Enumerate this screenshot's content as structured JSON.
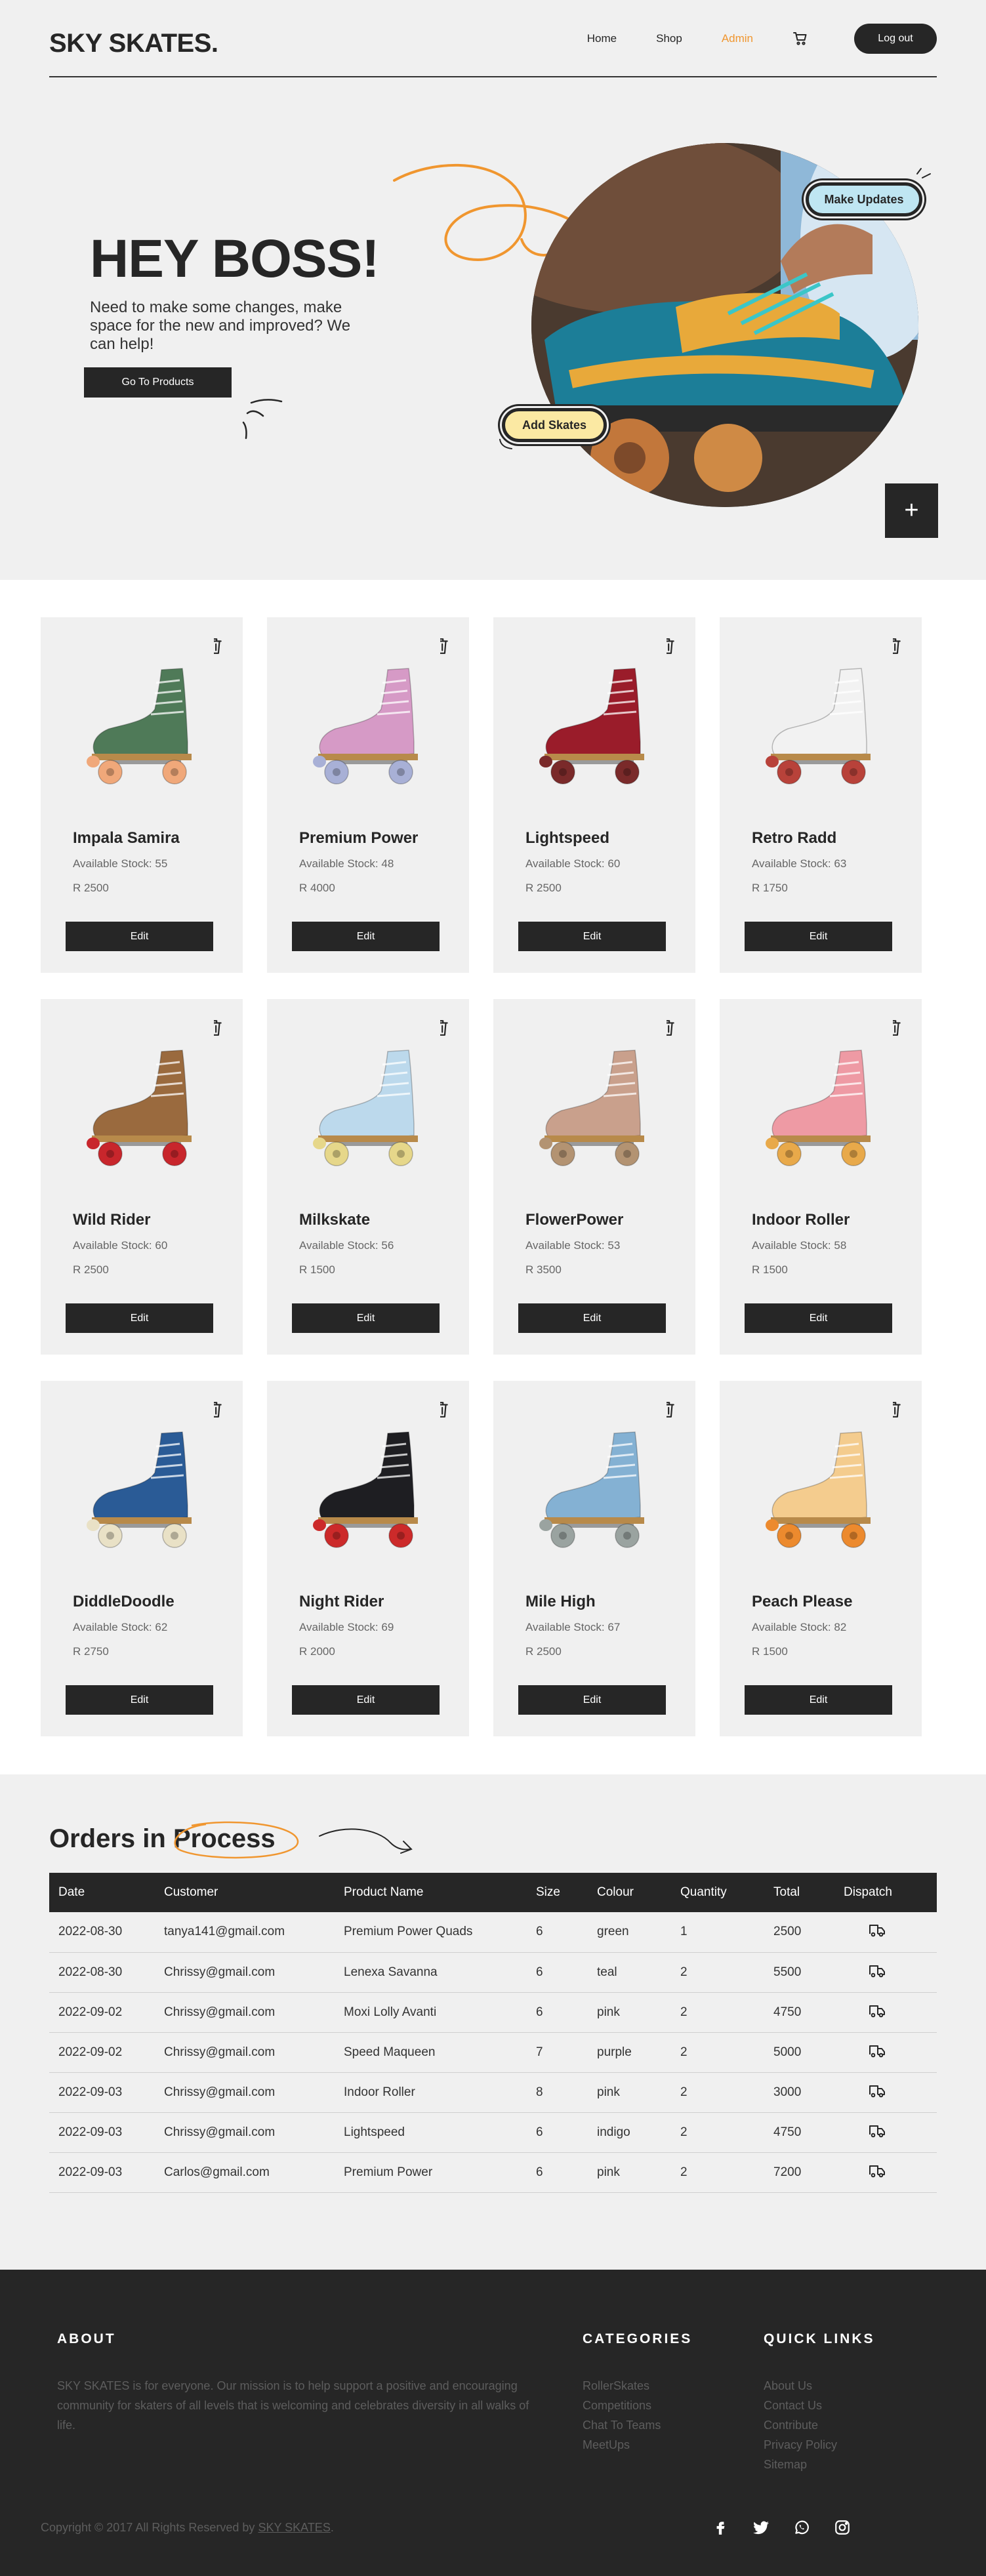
{
  "nav": {
    "brand": "SKY SKATES.",
    "links": [
      {
        "label": "Home"
      },
      {
        "label": "Shop"
      },
      {
        "label": "Admin"
      }
    ],
    "active_link": "Admin",
    "logout_label": "Log out",
    "cart_icon": "cart-icon"
  },
  "hero": {
    "title": "HEY BOSS!",
    "subtitle": "Need to make some changes, make space for the new and improved? We can help!",
    "cta_label": "Go To Products",
    "make_updates_label": "Make Updates",
    "add_skates_label": "Add Skates",
    "plus_label": "+"
  },
  "products": [
    {
      "name": "Impala Samira",
      "stock": "Available Stock: 55",
      "price": "R 2500",
      "boot": "#4f7a58",
      "wheel": "#f0a87a"
    },
    {
      "name": "Premium Power",
      "stock": "Available Stock: 48",
      "price": "R 4000",
      "boot": "#d69ac6",
      "wheel": "#a8b0d6"
    },
    {
      "name": "Lightspeed",
      "stock": "Available Stock: 60",
      "price": "R 2500",
      "boot": "#9a1c2a",
      "wheel": "#7a2a2a"
    },
    {
      "name": "Retro Radd",
      "stock": "Available Stock: 63",
      "price": "R 1750",
      "boot": "#f2f2f2",
      "wheel": "#b8423a"
    },
    {
      "name": "Wild Rider",
      "stock": "Available Stock: 60",
      "price": "R 2500",
      "boot": "#9a6a3e",
      "wheel": "#c8262c"
    },
    {
      "name": "Milkskate",
      "stock": "Available Stock: 56",
      "price": "R 1500",
      "boot": "#bcd9ec",
      "wheel": "#e6d78a"
    },
    {
      "name": "FlowerPower",
      "stock": "Available Stock: 53",
      "price": "R 3500",
      "boot": "#c9a08c",
      "wheel": "#b39372"
    },
    {
      "name": "Indoor Roller",
      "stock": "Available Stock: 58",
      "price": "R 1500",
      "boot": "#ee9aa4",
      "wheel": "#e8a94a"
    },
    {
      "name": "DiddleDoodle",
      "stock": "Available Stock: 62",
      "price": "R 2750",
      "boot": "#2a5b96",
      "wheel": "#e9e1c6"
    },
    {
      "name": "Night Rider",
      "stock": "Available Stock: 69",
      "price": "R 2000",
      "boot": "#1e1e22",
      "wheel": "#cc2a2a"
    },
    {
      "name": "Mile High",
      "stock": "Available Stock: 67",
      "price": "R 2500",
      "boot": "#84b1d3",
      "wheel": "#9aa3a0"
    },
    {
      "name": "Peach Please",
      "stock": "Available Stock: 82",
      "price": "R 1500",
      "boot": "#f4cc8e",
      "wheel": "#ec8a2e"
    }
  ],
  "edit_label": "Edit",
  "orders": {
    "title_part1": "Orders in ",
    "title_part2": "Process",
    "columns": [
      "Date",
      "Customer",
      "Product Name",
      "Size",
      "Colour",
      "Quantity",
      "Total",
      "Dispatch"
    ],
    "rows": [
      [
        "2022-08-30",
        "tanya141@gmail.com",
        "Premium Power Quads",
        "6",
        "green",
        "1",
        "2500"
      ],
      [
        "2022-08-30",
        "Chrissy@gmail.com",
        "Lenexa Savanna",
        "6",
        "teal",
        "2",
        "5500"
      ],
      [
        "2022-09-02",
        "Chrissy@gmail.com",
        "Moxi Lolly Avanti",
        "6",
        "pink",
        "2",
        "4750"
      ],
      [
        "2022-09-02",
        "Chrissy@gmail.com",
        "Speed Maqueen",
        "7",
        "purple",
        "2",
        "5000"
      ],
      [
        "2022-09-03",
        "Chrissy@gmail.com",
        "Indoor Roller",
        "8",
        "pink",
        "2",
        "3000"
      ],
      [
        "2022-09-03",
        "Chrissy@gmail.com",
        "Lightspeed",
        "6",
        "indigo",
        "2",
        "4750"
      ],
      [
        "2022-09-03",
        "Carlos@gmail.com",
        "Premium Power",
        "6",
        "pink",
        "2",
        "7200"
      ]
    ],
    "dispatch_icon": "truck-icon"
  },
  "footer": {
    "about_heading": "ABOUT",
    "about_text": "SKY SKATES is for everyone. Our mission is to help support a positive and encouraging community for skaters of all levels that is welcoming and celebrates diversity in all walks of life.",
    "categories_heading": "CATEGORIES",
    "categories": [
      "RollerSkates",
      "Competitions",
      "Chat To Teams",
      "MeetUps"
    ],
    "quicklinks_heading": "QUICK LINKS",
    "quicklinks": [
      "About Us",
      "Contact Us",
      "Contribute",
      "Privacy Policy",
      "Sitemap"
    ],
    "copyright_prefix": "Copyright © 2017 All Rights Reserved by ",
    "copyright_brand": "SKY SKATES",
    "copyright_suffix": ".",
    "socials": [
      "facebook-icon",
      "twitter-icon",
      "whatsapp-icon",
      "instagram-icon"
    ]
  },
  "colors": {
    "accent": "#f0962f",
    "dark": "#262626",
    "background": "#f0f0f0"
  }
}
